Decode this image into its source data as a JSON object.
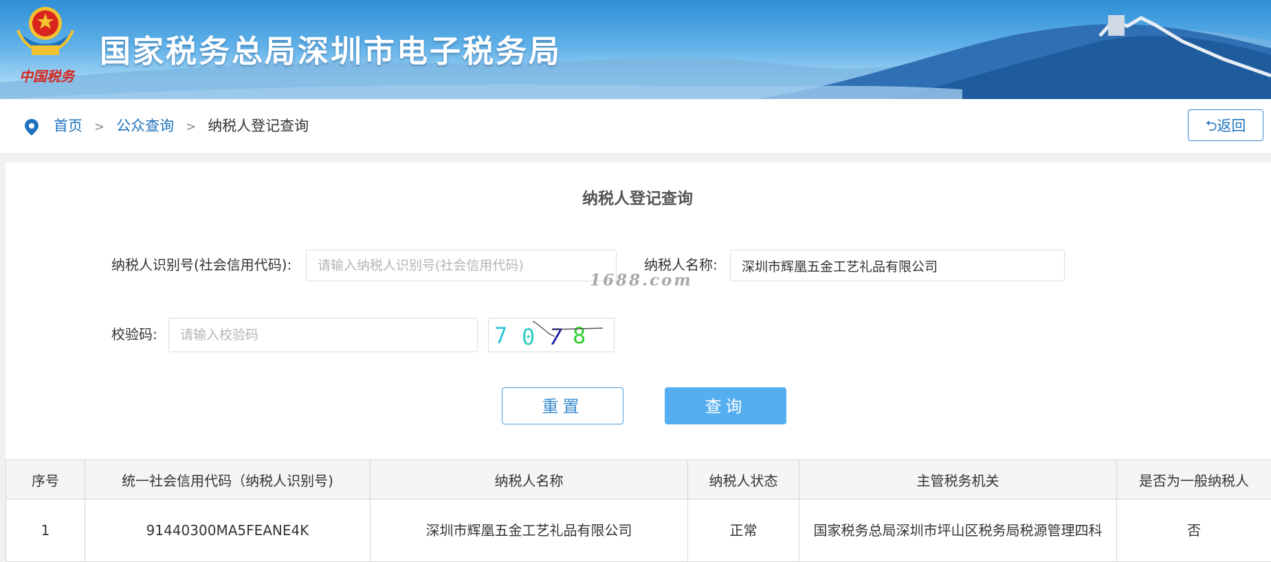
{
  "header": {
    "emblem_text": "中国税务",
    "title": "国家税务总局深圳市电子税务局"
  },
  "breadcrumb": {
    "items": [
      "首页",
      "公众查询"
    ],
    "separator": ">",
    "current": "纳税人登记查询",
    "back_label": "⮌返回"
  },
  "form": {
    "title": "纳税人登记查询",
    "taxpayer_id_label": "纳税人识别号(社会信用代码):",
    "taxpayer_id_placeholder": "请输入纳税人识别号(社会信用代码)",
    "taxpayer_id_value": "",
    "taxpayer_name_label": "纳税人名称:",
    "taxpayer_name_value": "深圳市辉凰五金工艺礼品有限公司",
    "captcha_label": "校验码:",
    "captcha_placeholder": "请输入校验码",
    "captcha_value": "",
    "captcha_digits": [
      "7",
      "0",
      "7",
      "8"
    ],
    "captcha_colors": [
      "#28c6d8",
      "#2ec9c2",
      "#1a1aa8",
      "#2fd02f"
    ],
    "reset_label": "重置",
    "query_label": "查询"
  },
  "watermark": "1688.com",
  "table": {
    "columns": [
      "序号",
      "统一社会信用代码（纳税人识别号)",
      "纳税人名称",
      "纳税人状态",
      "主管税务机关",
      "是否为一般纳税人"
    ],
    "rows": [
      {
        "index": "1",
        "credit_code": "91440300MA5FEANE4K",
        "name": "深圳市辉凰五金工艺礼品有限公司",
        "status": "正常",
        "authority": "国家税务总局深圳市坪山区税务局税源管理四科",
        "general_taxpayer": "否"
      }
    ]
  },
  "colors": {
    "accent": "#1e73be",
    "primary_button": "#55aef0",
    "banner_top": "#2e8fd6",
    "emblem_red": "#d9251d",
    "emblem_gold": "#f2c230"
  }
}
